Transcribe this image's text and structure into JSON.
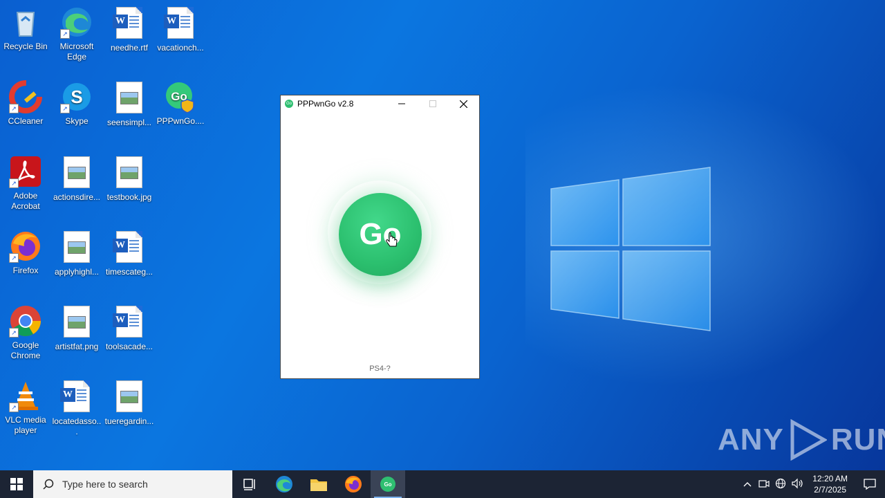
{
  "desktop": {
    "icons": [
      {
        "label": "Recycle Bin"
      },
      {
        "label": "Microsoft Edge"
      },
      {
        "label": "needhe.rtf"
      },
      {
        "label": "vacationch..."
      },
      {
        "label": "CCleaner"
      },
      {
        "label": "Skype"
      },
      {
        "label": "seensimpl..."
      },
      {
        "label": "PPPwnGo...."
      },
      {
        "label": "Adobe Acrobat"
      },
      {
        "label": "actionsdire..."
      },
      {
        "label": "testbook.jpg"
      },
      {
        "label": "Firefox"
      },
      {
        "label": "applyhighl..."
      },
      {
        "label": "timescateg..."
      },
      {
        "label": "Google Chrome"
      },
      {
        "label": "artistfat.png"
      },
      {
        "label": "toolsacade..."
      },
      {
        "label": "VLC media player"
      },
      {
        "label": "locatedasso..."
      },
      {
        "label": "tueregardin..."
      }
    ]
  },
  "window": {
    "title": "PPPwnGo v2.8",
    "go_label": "Go",
    "status": "PS4-?",
    "app_icon_text": "Go"
  },
  "watermark": {
    "left": "ANY",
    "right": "RUN"
  },
  "taskbar": {
    "search_placeholder": "Type here to search",
    "active_app_text": "Go",
    "time": "12:20 AM",
    "date": "2/7/2025"
  },
  "colors": {
    "go_green": "#2bbf6e",
    "taskbar": "#1c2434",
    "wallpaper": "#0b76e0"
  }
}
